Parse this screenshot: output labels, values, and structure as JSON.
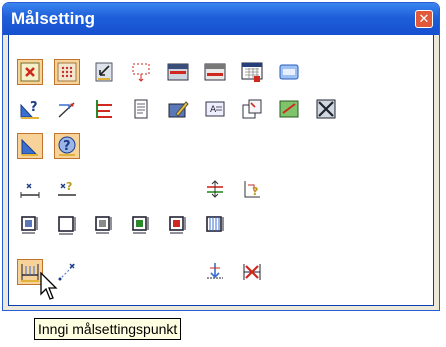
{
  "window": {
    "title": "Målsetting",
    "close_icon": "close-icon"
  },
  "tooltip": {
    "text": "Inngi målsettingspunkt"
  },
  "colors": {
    "titlebar": "#2462dd",
    "active_tool": "#f7d39a",
    "tooltip_bg": "#ffffe1"
  },
  "tools": [
    {
      "name": "tool-red-x-frame",
      "row": 0,
      "col": 0,
      "active": true
    },
    {
      "name": "tool-grid-dots",
      "row": 0,
      "col": 1,
      "active": true
    },
    {
      "name": "tool-arrow-down-left",
      "row": 0,
      "col": 2
    },
    {
      "name": "tool-dashed-rect",
      "row": 0,
      "col": 3
    },
    {
      "name": "tool-window-red",
      "row": 0,
      "col": 4
    },
    {
      "name": "tool-window-gray",
      "row": 0,
      "col": 5
    },
    {
      "name": "tool-grid-red",
      "row": 0,
      "col": 6
    },
    {
      "name": "tool-window-blue",
      "row": 0,
      "col": 7
    },
    {
      "name": "tool-triangle-help",
      "row": 1,
      "col": 0
    },
    {
      "name": "tool-arrow-diag",
      "row": 1,
      "col": 1
    },
    {
      "name": "tool-corner-bars",
      "row": 1,
      "col": 2
    },
    {
      "name": "tool-document",
      "row": 1,
      "col": 3
    },
    {
      "name": "tool-edit-pencil",
      "row": 1,
      "col": 4
    },
    {
      "name": "tool-text-box",
      "row": 1,
      "col": 5
    },
    {
      "name": "tool-copy-pages",
      "row": 1,
      "col": 6
    },
    {
      "name": "tool-green-frame",
      "row": 1,
      "col": 7
    },
    {
      "name": "tool-cross-box",
      "row": 1,
      "col": 8
    },
    {
      "name": "tool-triangle-ruler",
      "row": 2,
      "col": 0,
      "active": true
    },
    {
      "name": "tool-help-ruler",
      "row": 2,
      "col": 1,
      "active": true
    },
    {
      "name": "tool-point-line",
      "row": 3,
      "col": 0
    },
    {
      "name": "tool-point-help",
      "row": 3,
      "col": 1
    },
    {
      "name": "tool-dim-adjust",
      "row": 3,
      "col": 5
    },
    {
      "name": "tool-dim-help",
      "row": 3,
      "col": 6
    },
    {
      "name": "tool-box-dim-1",
      "row": 4,
      "col": 0
    },
    {
      "name": "tool-box-empty",
      "row": 4,
      "col": 1
    },
    {
      "name": "tool-box-dim-2",
      "row": 4,
      "col": 2
    },
    {
      "name": "tool-box-dim-3",
      "row": 4,
      "col": 3
    },
    {
      "name": "tool-box-dim-4",
      "row": 4,
      "col": 4
    },
    {
      "name": "tool-box-columns",
      "row": 4,
      "col": 5
    },
    {
      "name": "tool-dim-point",
      "row": 5,
      "col": 0,
      "active": true
    },
    {
      "name": "tool-dim-diagonal",
      "row": 5,
      "col": 1
    },
    {
      "name": "tool-dim-move",
      "row": 5,
      "col": 5
    },
    {
      "name": "tool-dim-delete",
      "row": 5,
      "col": 6
    }
  ]
}
